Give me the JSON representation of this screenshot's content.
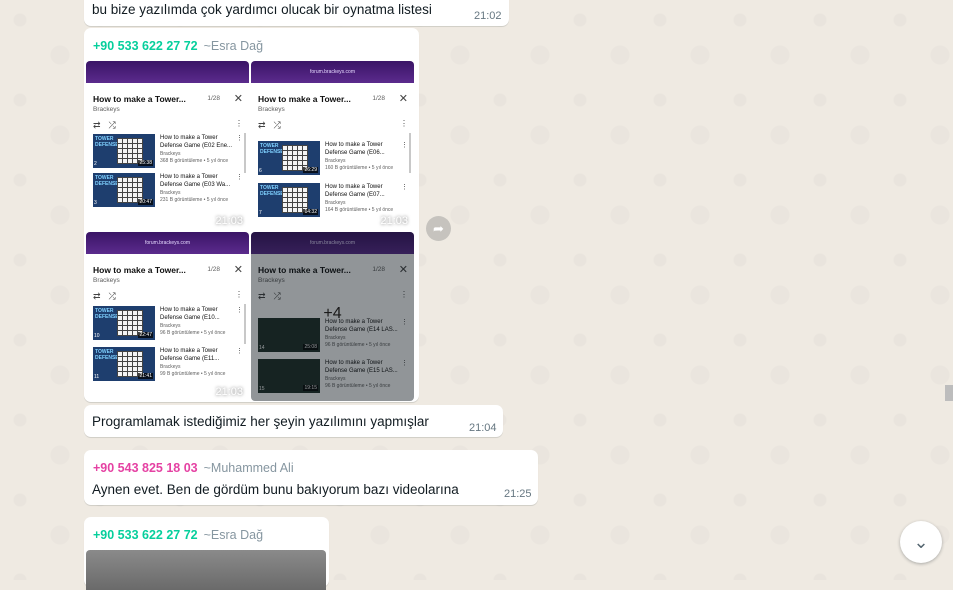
{
  "messages": [
    {
      "text": "bu bize yazılımda çok yardımcı olucak bir oynatma listesi",
      "time": "21:02"
    },
    {
      "sender_phone": "+90 533 622 27 72",
      "sender_name": "~Esra Dağ",
      "images": [
        {
          "time": "21:03"
        },
        {
          "time": "21:03"
        },
        {
          "time": "21:03"
        },
        {
          "more": "+4"
        }
      ]
    },
    {
      "text": "Programlamak istediğimiz her şeyin yazılımını yapmışlar",
      "time": "21:04"
    },
    {
      "sender_phone": "+90 543 825 18 03",
      "sender_name": "~Muhammed Ali",
      "text": "Aynen evet. Ben de gördüm bunu bakıyorum bazı videolarına",
      "time": "21:25"
    },
    {
      "sender_phone": "+90 533 622 27 72",
      "sender_name": "~Esra Dağ"
    }
  ],
  "playlist": {
    "site": "forum.brackeys.com",
    "title": "How to make a Tower...",
    "channel": "Brackeys",
    "counts": [
      "1/28",
      "1/28",
      "1/28",
      "1/28"
    ],
    "thumb_label": "TOWER DEFENSE",
    "video_a": {
      "title": "How to make a Tower Defense Game (E02 Ene...",
      "meta": "368 B görüntüleme • 5 yıl önce",
      "dur": "25:38",
      "idx": "2"
    },
    "video_b": {
      "title": "How to make a Tower Defense Game (E03 Wa...",
      "meta": "231 B görüntüleme • 5 yıl önce",
      "dur": "20:47",
      "idx": "3"
    },
    "video_c": {
      "title": "How to make a Tower Defense Game (E06...",
      "meta": "160 B görüntüleme • 5 yıl önce",
      "dur": "26:29",
      "idx": "6"
    },
    "video_d": {
      "title": "How to make a Tower Defense Game (E07...",
      "meta": "164 B görüntüleme • 5 yıl önce",
      "dur": "14:32",
      "idx": "7"
    },
    "video_e": {
      "title": "How to make a Tower Defense Game (E10...",
      "meta": "96 B görüntüleme • 5 yıl önce",
      "dur": "22:47",
      "idx": "10"
    },
    "video_f": {
      "title": "How to make a Tower Defense Game (E11...",
      "meta": "99 B görüntüleme • 5 yıl önce",
      "dur": "21:41",
      "idx": "11"
    },
    "video_g": {
      "title": "How to make a Tower Defense Game (E14 LAS...",
      "meta": "96 B görüntüleme • 5 yıl önce",
      "dur": "25:08",
      "idx": "14"
    },
    "video_h": {
      "title": "How to make a Tower Defense Game (E15 LAS...",
      "meta": "96 B görüntüleme • 5 yıl önce",
      "dur": "19:15",
      "idx": "15"
    }
  },
  "icons": {
    "forward": "forward-icon",
    "scroll_down": "chevron-down-icon"
  }
}
